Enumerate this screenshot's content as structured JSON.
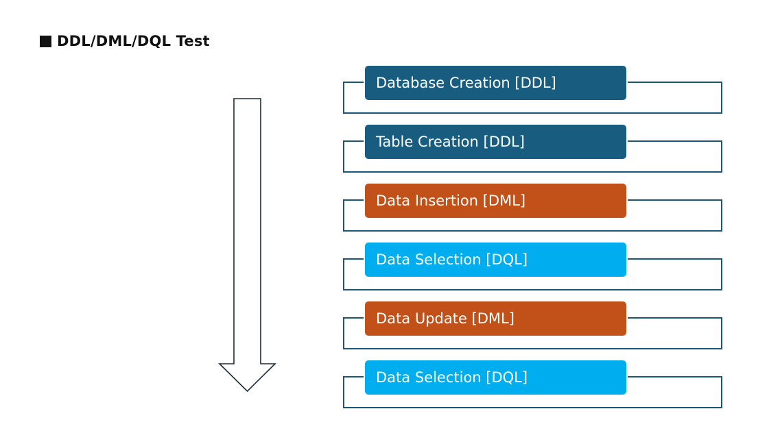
{
  "title": "DDL/DML/DQL Test",
  "colors": {
    "ddl": "#185d80",
    "dml": "#c25119",
    "dql": "#00aeef",
    "frame": "#1a5678"
  },
  "steps": [
    {
      "label": "Database Creation [DDL]",
      "kind": "ddl"
    },
    {
      "label": "Table Creation [DDL]",
      "kind": "ddl"
    },
    {
      "label": "Data Insertion [DML]",
      "kind": "dml"
    },
    {
      "label": "Data Selection [DQL]",
      "kind": "dql"
    },
    {
      "label": "Data Update [DML]",
      "kind": "dml"
    },
    {
      "label": "Data Selection [DQL]",
      "kind": "dql"
    }
  ]
}
